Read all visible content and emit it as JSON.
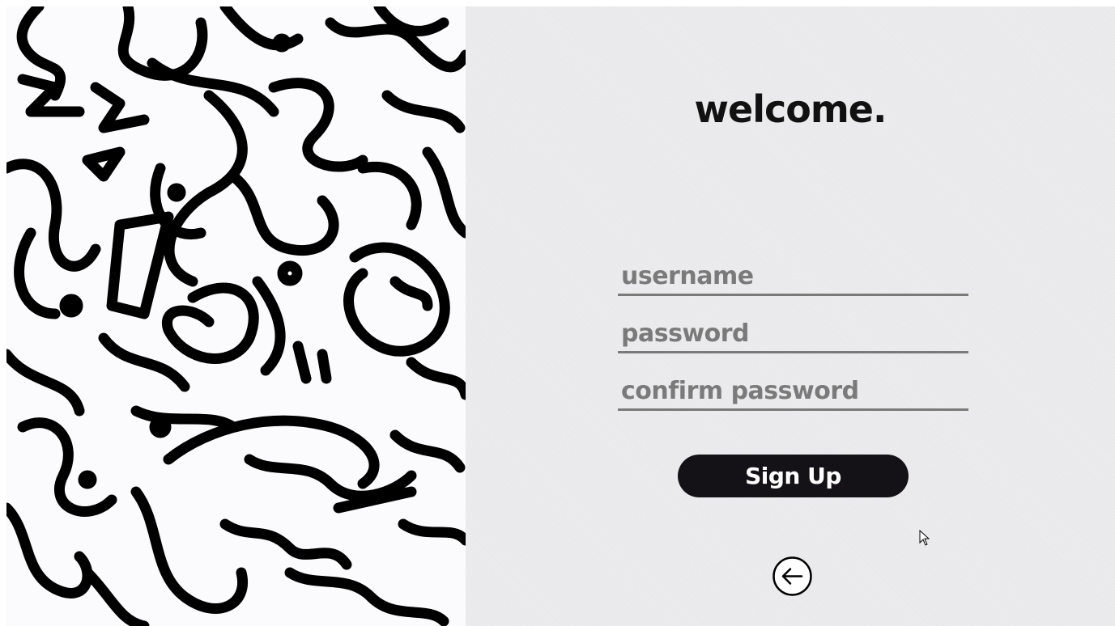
{
  "signup": {
    "title": "welcome.",
    "username_placeholder": "username",
    "password_placeholder": "password",
    "confirm_placeholder": "confirm password",
    "button_label": "Sign Up"
  },
  "icons": {
    "back": "arrow-left-circle-icon",
    "cursor": "mouse-pointer-icon"
  },
  "colors": {
    "form_background": "#ececee",
    "button_background": "#141217",
    "button_text": "#ffffff",
    "title_text": "#111111",
    "field_underline": "#7a7a7a",
    "pattern_ink": "#000000",
    "pattern_background": "#fbfbfd"
  }
}
